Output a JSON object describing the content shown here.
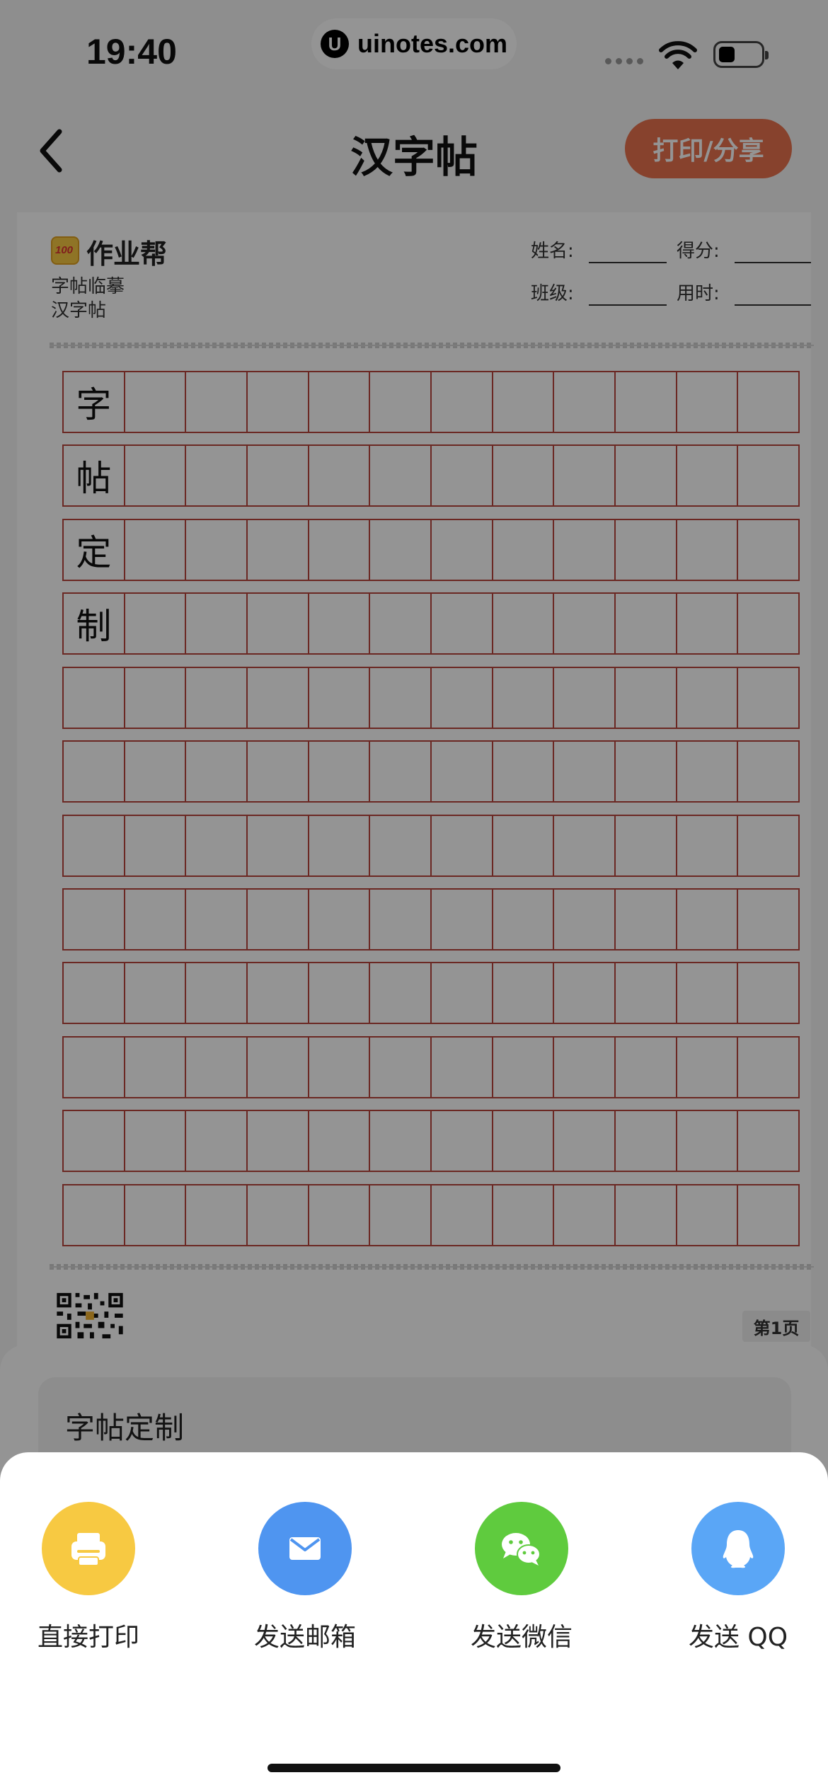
{
  "status_bar": {
    "time": "19:40",
    "site": "uinotes.com",
    "site_logo": "U"
  },
  "nav": {
    "title": "汉字帖",
    "share_label": "打印/分享"
  },
  "paper": {
    "brand": "作业帮",
    "logo_text": "100",
    "subtitle_1": "字帖临摹",
    "subtitle_2": "汉字帖",
    "fields": {
      "name": "姓名:",
      "score": "得分:",
      "class": "班级:",
      "time": "用时:"
    },
    "rows": [
      [
        "字",
        "",
        "",
        "",
        "",
        "",
        "",
        "",
        "",
        "",
        "",
        ""
      ],
      [
        "帖",
        "",
        "",
        "",
        "",
        "",
        "",
        "",
        "",
        "",
        "",
        ""
      ],
      [
        "定",
        "",
        "",
        "",
        "",
        "",
        "",
        "",
        "",
        "",
        "",
        ""
      ],
      [
        "制",
        "",
        "",
        "",
        "",
        "",
        "",
        "",
        "",
        "",
        "",
        ""
      ],
      [
        "",
        "",
        "",
        "",
        "",
        "",
        "",
        "",
        "",
        "",
        "",
        ""
      ],
      [
        "",
        "",
        "",
        "",
        "",
        "",
        "",
        "",
        "",
        "",
        "",
        ""
      ],
      [
        "",
        "",
        "",
        "",
        "",
        "",
        "",
        "",
        "",
        "",
        "",
        ""
      ],
      [
        "",
        "",
        "",
        "",
        "",
        "",
        "",
        "",
        "",
        "",
        "",
        ""
      ],
      [
        "",
        "",
        "",
        "",
        "",
        "",
        "",
        "",
        "",
        "",
        "",
        ""
      ],
      [
        "",
        "",
        "",
        "",
        "",
        "",
        "",
        "",
        "",
        "",
        "",
        ""
      ],
      [
        "",
        "",
        "",
        "",
        "",
        "",
        "",
        "",
        "",
        "",
        "",
        ""
      ],
      [
        "",
        "",
        "",
        "",
        "",
        "",
        "",
        "",
        "",
        "",
        "",
        ""
      ]
    ],
    "page_label": "第1页"
  },
  "custom_panel": {
    "title": "字帖定制"
  },
  "share_sheet": {
    "options": [
      {
        "label": "直接打印",
        "icon": "printer-icon",
        "color": "#f7c942"
      },
      {
        "label": "发送邮箱",
        "icon": "mail-icon",
        "color": "#4f95f0"
      },
      {
        "label": "发送微信",
        "icon": "wechat-icon",
        "color": "#5fcb3e"
      },
      {
        "label": "发送 QQ",
        "icon": "qq-icon",
        "color": "#5aa6f6"
      }
    ]
  }
}
